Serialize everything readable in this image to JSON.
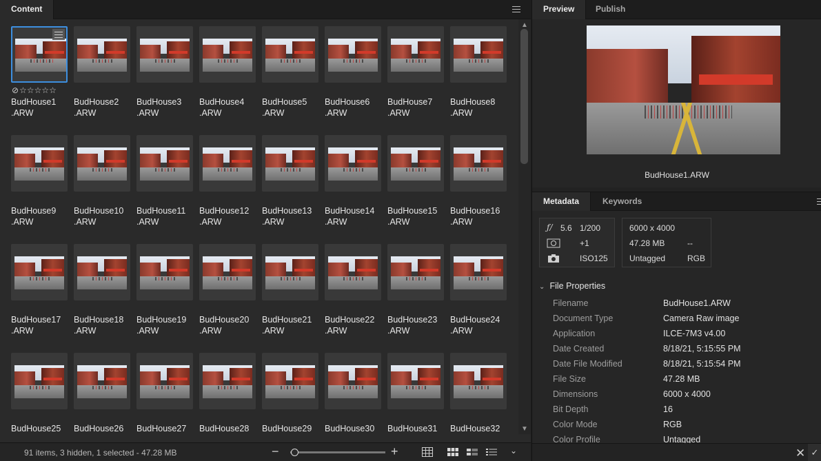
{
  "content_panel": {
    "tab_label": "Content",
    "status_text": "91 items, 3 hidden, 1 selected - 47.28 MB",
    "items": [
      {
        "name": "BudHouse1\n.ARW",
        "selected": true
      },
      {
        "name": "BudHouse2\n.ARW"
      },
      {
        "name": "BudHouse3\n.ARW"
      },
      {
        "name": "BudHouse4\n.ARW"
      },
      {
        "name": "BudHouse5\n.ARW"
      },
      {
        "name": "BudHouse6\n.ARW"
      },
      {
        "name": "BudHouse7\n.ARW"
      },
      {
        "name": "BudHouse8\n.ARW"
      },
      {
        "name": "BudHouse9\n.ARW"
      },
      {
        "name": "BudHouse10\n.ARW"
      },
      {
        "name": "BudHouse11\n.ARW"
      },
      {
        "name": "BudHouse12\n.ARW"
      },
      {
        "name": "BudHouse13\n.ARW"
      },
      {
        "name": "BudHouse14\n.ARW"
      },
      {
        "name": "BudHouse15\n.ARW"
      },
      {
        "name": "BudHouse16\n.ARW"
      },
      {
        "name": "BudHouse17\n.ARW"
      },
      {
        "name": "BudHouse18\n.ARW"
      },
      {
        "name": "BudHouse19\n.ARW"
      },
      {
        "name": "BudHouse20\n.ARW"
      },
      {
        "name": "BudHouse21\n.ARW"
      },
      {
        "name": "BudHouse22\n.ARW"
      },
      {
        "name": "BudHouse23\n.ARW"
      },
      {
        "name": "BudHouse24\n.ARW"
      },
      {
        "name": "BudHouse25"
      },
      {
        "name": "BudHouse26"
      },
      {
        "name": "BudHouse27"
      },
      {
        "name": "BudHouse28"
      },
      {
        "name": "BudHouse29"
      },
      {
        "name": "BudHouse30"
      },
      {
        "name": "BudHouse31"
      },
      {
        "name": "BudHouse32"
      }
    ],
    "rating": {
      "reject_icon": "reject-icon",
      "stars": "☆☆☆☆☆"
    }
  },
  "preview_panel": {
    "tabs": [
      "Preview",
      "Publish"
    ],
    "active_tab": "Preview",
    "filename": "BudHouse1.ARW"
  },
  "metadata_panel": {
    "tabs": [
      "Metadata",
      "Keywords"
    ],
    "active_tab": "Metadata",
    "exif": {
      "aperture": "5.6",
      "shutter": "1/200",
      "exposure_comp": "+1",
      "iso": "ISO125"
    },
    "file_summary": {
      "dimensions": "6000 x 4000",
      "size": "47.28 MB",
      "extra": "--",
      "profile": "Untagged",
      "color_mode": "RGB"
    },
    "file_properties": {
      "header": "File Properties",
      "rows": [
        {
          "label": "Filename",
          "value": "BudHouse1.ARW"
        },
        {
          "label": "Document Type",
          "value": "Camera Raw image"
        },
        {
          "label": "Application",
          "value": "ILCE-7M3 v4.00"
        },
        {
          "label": "Date Created",
          "value": "8/18/21, 5:15:55 PM"
        },
        {
          "label": "Date File Modified",
          "value": "8/18/21, 5:15:54 PM"
        },
        {
          "label": "File Size",
          "value": "47.28 MB"
        },
        {
          "label": "Dimensions",
          "value": "6000 x 4000"
        },
        {
          "label": "Bit Depth",
          "value": "16"
        },
        {
          "label": "Color Mode",
          "value": "RGB"
        },
        {
          "label": "Color Profile",
          "value": "Untagged"
        }
      ]
    }
  },
  "colors": {
    "selection": "#3d8fe0",
    "panel_bg": "#2a2a2a",
    "thumb_bg": "#393939"
  }
}
